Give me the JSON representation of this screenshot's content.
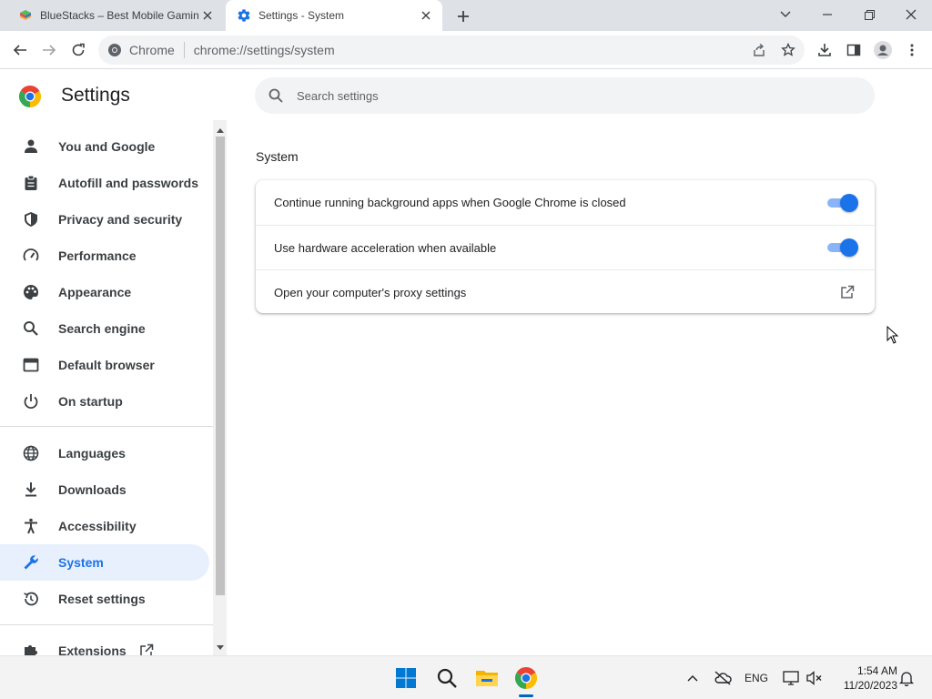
{
  "browser": {
    "tabs": [
      {
        "title": "BlueStacks – Best Mobile Gaming Platform for PC",
        "favicon": "bluestacks-icon",
        "active": false
      },
      {
        "title": "Settings - System",
        "favicon": "gear-icon",
        "active": true
      }
    ],
    "omnibox": {
      "chip": "Chrome",
      "url": "chrome://settings/system"
    }
  },
  "settings": {
    "title": "Settings",
    "search": {
      "placeholder": "Search settings",
      "value": ""
    },
    "nav": [
      {
        "label": "You and Google",
        "icon": "person-icon",
        "active": false
      },
      {
        "label": "Autofill and passwords",
        "icon": "clipboard-icon",
        "active": false
      },
      {
        "label": "Privacy and security",
        "icon": "shield-icon",
        "active": false
      },
      {
        "label": "Performance",
        "icon": "gauge-icon",
        "active": false
      },
      {
        "label": "Appearance",
        "icon": "palette-icon",
        "active": false
      },
      {
        "label": "Search engine",
        "icon": "search-icon",
        "active": false
      },
      {
        "label": "Default browser",
        "icon": "browser-window-icon",
        "active": false
      },
      {
        "label": "On startup",
        "icon": "power-icon",
        "active": false
      },
      {
        "label": "Languages",
        "icon": "globe-icon",
        "active": false
      },
      {
        "label": "Downloads",
        "icon": "download-icon",
        "active": false
      },
      {
        "label": "Accessibility",
        "icon": "accessibility-icon",
        "active": false
      },
      {
        "label": "System",
        "icon": "wrench-icon",
        "active": true
      },
      {
        "label": "Reset settings",
        "icon": "reset-icon",
        "active": false
      },
      {
        "label": "Extensions",
        "icon": "puzzle-icon",
        "active": false
      }
    ],
    "section": {
      "title": "System",
      "rows": [
        {
          "label": "Continue running background apps when Google Chrome is closed",
          "control": "toggle",
          "checked": true
        },
        {
          "label": "Use hardware acceleration when available",
          "control": "toggle",
          "checked": true
        },
        {
          "label": "Open your computer's proxy settings",
          "control": "external-link"
        }
      ]
    }
  },
  "taskbar": {
    "apps": [
      "windows-start-icon",
      "search-icon",
      "file-explorer-icon",
      "chrome-icon"
    ],
    "tray": {
      "language": "ENG"
    },
    "clock": {
      "time": "1:54 AM",
      "date": "11/20/2023"
    }
  },
  "colors": {
    "accent": "#1a73e8",
    "active_nav_bg": "#e8f0fe",
    "toggle_track": "#8ab4f8"
  }
}
